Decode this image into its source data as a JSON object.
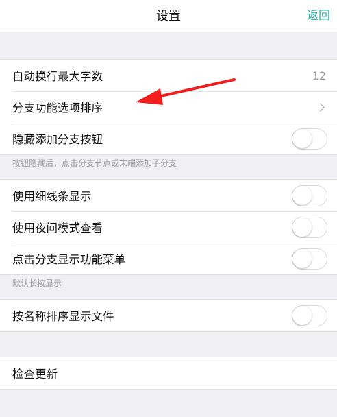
{
  "navbar": {
    "title": "设置",
    "back_label": "返回"
  },
  "group1": {
    "rows": [
      {
        "label": "自动换行最大字数",
        "value": "12"
      },
      {
        "label": "分支功能选项排序"
      },
      {
        "label": "隐藏添加分支按钮",
        "toggle_on": false
      }
    ],
    "note": "按钮隐藏后，点击分支节点或末端添加子分支"
  },
  "group2": {
    "rows": [
      {
        "label": "使用细线条显示",
        "toggle_on": false
      },
      {
        "label": "使用夜间模式查看",
        "toggle_on": false
      },
      {
        "label": "点击分支显示功能菜单",
        "toggle_on": false
      }
    ],
    "note": "默认长按显示"
  },
  "group3": {
    "rows": [
      {
        "label": "按名称排序显示文件",
        "toggle_on": false
      }
    ]
  },
  "group4": {
    "rows": [
      {
        "label": "检查更新"
      }
    ]
  },
  "annotation": {
    "arrow_color": "#f21d1d"
  }
}
